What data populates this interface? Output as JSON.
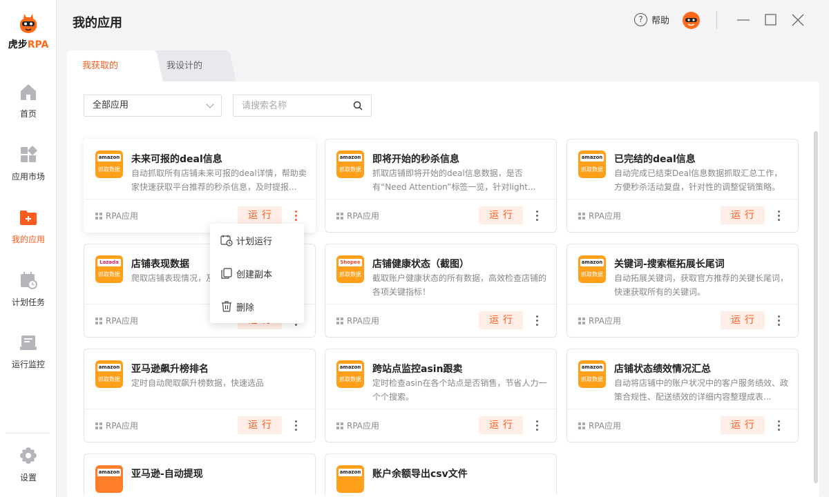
{
  "app": {
    "brand_prefix": "虎步",
    "brand_suffix": "RPA"
  },
  "sidebar": {
    "items": [
      {
        "label": "首页",
        "icon": "home-icon"
      },
      {
        "label": "应用市场",
        "icon": "apps-market-icon"
      },
      {
        "label": "我的应用",
        "icon": "folder-plus-icon",
        "active": true
      },
      {
        "label": "计划任务",
        "icon": "calendar-clock-icon"
      },
      {
        "label": "运行监控",
        "icon": "monitor-icon"
      },
      {
        "label": "设置",
        "icon": "gear-icon"
      }
    ]
  },
  "header": {
    "title": "我的应用",
    "help_label": "帮助",
    "help_icon": "?"
  },
  "tabs": [
    {
      "label": "我获取的",
      "active": true
    },
    {
      "label": "我设计的",
      "active": false
    }
  ],
  "filters": {
    "category_value": "全部应用",
    "search_placeholder": "请搜索名称"
  },
  "cards": [
    {
      "brand": "amazon",
      "icon_label": "抓取数据",
      "title": "未来可报的deal信息",
      "desc": "自动抓取所有店铺未来可报的deal详情，帮助卖家快速获取平台推荐的秒杀信息，及时提报...",
      "type": "RPA应用",
      "run": "运行"
    },
    {
      "brand": "amazon",
      "icon_label": "抓取数据",
      "title": "即将开始的秒杀信息",
      "desc": "抓取店铺即将开始的deal信息数据，是否有“Need Attention”标签一览，针对light...",
      "type": "RPA应用",
      "run": "运行"
    },
    {
      "brand": "amazon",
      "icon_label": "抓取数据",
      "title": "已完结的deal信息",
      "desc": "自动完成已结束Deal信息数据抓取汇总工作，方便秒杀活动复盘，针对性的调整促销策略。",
      "type": "RPA应用",
      "run": "运行"
    },
    {
      "brand": "Lazada",
      "icon_label": "抓取数据",
      "title": "店铺表现数据",
      "desc": "爬取店铺表现情况，及",
      "type": "RPA应用",
      "run": "运行"
    },
    {
      "brand": "Shopee",
      "icon_label": "抓取数据",
      "title": "店铺健康状态（截图）",
      "desc": "截取账户健康状态的所有数据，高效检查店铺的各项关键指标！",
      "type": "RPA应用",
      "run": "运行"
    },
    {
      "brand": "amazon",
      "icon_label": "抓取数据",
      "title": "关键词-搜索框拓展长尾词",
      "desc": "自动拓展关键词，获取官方推荐的关键长尾词，快速获取所有的关键词。",
      "type": "RPA应用",
      "run": "运行"
    },
    {
      "brand": "amazon",
      "icon_label": "抓取数据",
      "title": "亚马逊飙升榜排名",
      "desc": "定时自动爬取飙升榜数据，快速选品",
      "type": "RPA应用",
      "run": "运行"
    },
    {
      "brand": "amazon",
      "icon_label": "抓取数据",
      "title": "跨站点监控asin跟卖",
      "desc": "定时检查asin在各个站点是否销售，节省人力一个个搜索。",
      "type": "RPA应用",
      "run": "运行"
    },
    {
      "brand": "amazon",
      "icon_label": "抓取数据",
      "title": "店铺状态绩效情况汇总",
      "desc": "自动将店铺中的账户状况中的客户服务绩效、政策合规性、配送绩效的详细内容整理成表...",
      "type": "RPA应用",
      "run": "运行"
    },
    {
      "brand": "amazon",
      "icon_label": "",
      "title": "亚马逊-自动提现",
      "desc": "",
      "type": "",
      "run": ""
    },
    {
      "brand": "amazon",
      "icon_label": "",
      "title": "账户余额导出csv文件",
      "desc": "",
      "type": "",
      "run": ""
    }
  ],
  "menu": {
    "items": [
      {
        "label": "计划运行",
        "icon": "schedule-run-icon"
      },
      {
        "label": "创建副本",
        "icon": "copy-icon"
      },
      {
        "label": "删除",
        "icon": "trash-icon"
      }
    ]
  },
  "colors": {
    "accent": "#ff5a1f",
    "run_bg": "#ffeee6",
    "app_icon_bg": "#ff9f1a"
  }
}
